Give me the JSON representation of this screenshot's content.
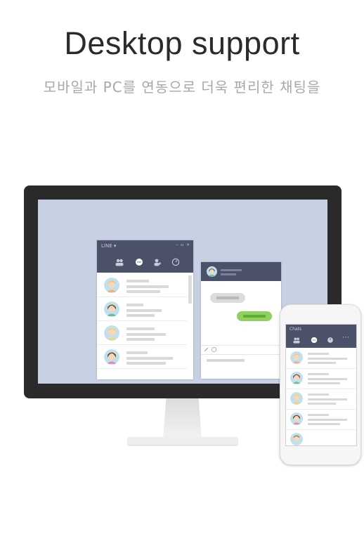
{
  "header": {
    "title": "Desktop support",
    "subtitle": "모바일과 PC를 연동으로 더욱 편리한 채팅을"
  },
  "desktop_window": {
    "app_name": "LINE ▾",
    "controls": "– ▫ ×",
    "tabs": [
      "friends-icon",
      "chat-icon",
      "add-friend-icon",
      "timeline-icon"
    ],
    "avatars": [
      "#f2c27a",
      "#7a5a3e",
      "#f5d47a",
      "#6b4a32"
    ]
  },
  "phone_screen": {
    "title": "Chats",
    "tabs": [
      "friends-icon",
      "chat-icon",
      "timeline-icon",
      "more-icon"
    ],
    "more": "⋯"
  },
  "colors": {
    "header_bar": "#4a5168",
    "screen_bg": "#c6d1e3",
    "sent_bubble": "#8fd05e",
    "received_bubble": "#dcdcdc"
  }
}
